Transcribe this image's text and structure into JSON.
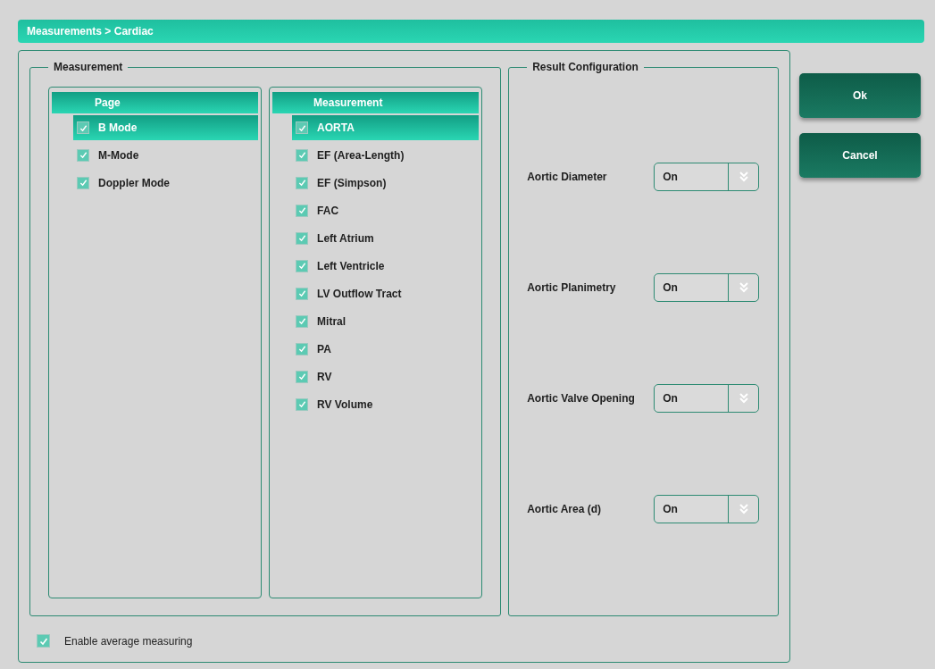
{
  "window": {
    "title": "Measurements > Cardiac"
  },
  "measurement_group": {
    "title": "Measurement",
    "pages": {
      "header": "Page",
      "items": [
        {
          "label": "B Mode",
          "checked": true,
          "selected": true
        },
        {
          "label": "M-Mode",
          "checked": true,
          "selected": false
        },
        {
          "label": "Doppler Mode",
          "checked": true,
          "selected": false
        }
      ]
    },
    "measurements": {
      "header": "Measurement",
      "items": [
        {
          "label": "AORTA",
          "checked": true,
          "selected": true
        },
        {
          "label": "EF (Area-Length)",
          "checked": true,
          "selected": false
        },
        {
          "label": "EF (Simpson)",
          "checked": true,
          "selected": false
        },
        {
          "label": "FAC",
          "checked": true,
          "selected": false
        },
        {
          "label": "Left Atrium",
          "checked": true,
          "selected": false
        },
        {
          "label": "Left Ventricle",
          "checked": true,
          "selected": false
        },
        {
          "label": "LV Outflow Tract",
          "checked": true,
          "selected": false
        },
        {
          "label": "Mitral",
          "checked": true,
          "selected": false
        },
        {
          "label": "PA",
          "checked": true,
          "selected": false
        },
        {
          "label": "RV",
          "checked": true,
          "selected": false
        },
        {
          "label": "RV Volume",
          "checked": true,
          "selected": false
        }
      ]
    }
  },
  "result_configuration": {
    "title": "Result Configuration",
    "rows": [
      {
        "label": "Aortic Diameter",
        "value": "On"
      },
      {
        "label": "Aortic Planimetry",
        "value": "On"
      },
      {
        "label": "Aortic Valve Opening",
        "value": "On"
      },
      {
        "label": "Aortic Area (d)",
        "value": "On"
      }
    ]
  },
  "enable_average": {
    "label": "Enable average measuring",
    "checked": true
  },
  "buttons": [
    "Ok",
    "Cancel"
  ]
}
